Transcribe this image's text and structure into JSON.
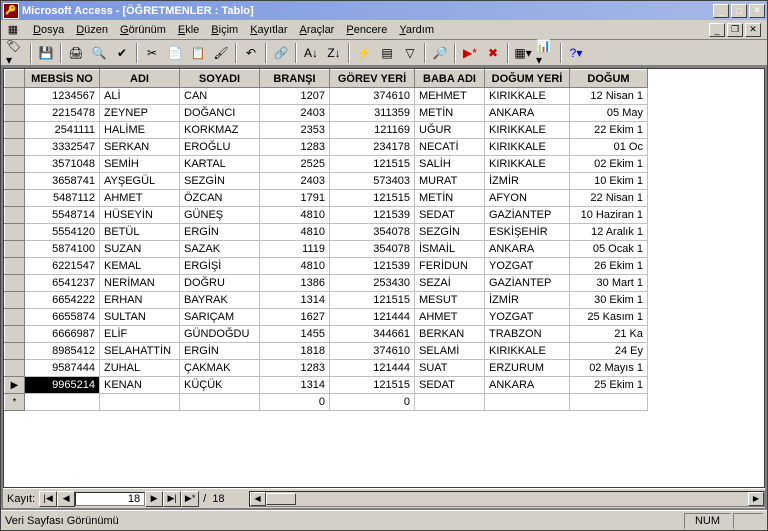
{
  "title": "Microsoft Access - [ÖĞRETMENLER : Tablo]",
  "menus": [
    "Dosya",
    "Düzen",
    "Görünüm",
    "Ekle",
    "Biçim",
    "Kayıtlar",
    "Araçlar",
    "Pencere",
    "Yardım"
  ],
  "columns": [
    "MEBSİS NO",
    "ADI",
    "SOYADI",
    "BRANŞI",
    "GÖREV YERİ",
    "BABA ADI",
    "DOĞUM YERİ",
    "DOĞUM"
  ],
  "rows": [
    {
      "sel": "",
      "mebsis": "1234567",
      "adi": "ALİ",
      "soyadi": "CAN",
      "bransi": "1207",
      "gorev": "374610",
      "baba": "MEHMET",
      "dogumyeri": "KIRIKKALE",
      "dogum": "12 Nisan 1"
    },
    {
      "sel": "",
      "mebsis": "2215478",
      "adi": "ZEYNEP",
      "soyadi": "DOĞANCI",
      "bransi": "2403",
      "gorev": "311359",
      "baba": "METİN",
      "dogumyeri": "ANKARA",
      "dogum": "05 May"
    },
    {
      "sel": "",
      "mebsis": "2541111",
      "adi": "HALİME",
      "soyadi": "KORKMAZ",
      "bransi": "2353",
      "gorev": "121169",
      "baba": "UĞUR",
      "dogumyeri": "KIRIKKALE",
      "dogum": "22 Ekim 1"
    },
    {
      "sel": "",
      "mebsis": "3332547",
      "adi": "SERKAN",
      "soyadi": "EROĞLU",
      "bransi": "1283",
      "gorev": "234178",
      "baba": "NECATİ",
      "dogumyeri": "KIRIKKALE",
      "dogum": "01 Oc"
    },
    {
      "sel": "",
      "mebsis": "3571048",
      "adi": "SEMİH",
      "soyadi": "KARTAL",
      "bransi": "2525",
      "gorev": "121515",
      "baba": "SALİH",
      "dogumyeri": "KIRIKKALE",
      "dogum": "02 Ekim 1"
    },
    {
      "sel": "",
      "mebsis": "3658741",
      "adi": "AYŞEGÜL",
      "soyadi": "SEZGİN",
      "bransi": "2403",
      "gorev": "573403",
      "baba": "MURAT",
      "dogumyeri": "İZMİR",
      "dogum": "10 Ekim 1"
    },
    {
      "sel": "",
      "mebsis": "5487112",
      "adi": "AHMET",
      "soyadi": "ÖZCAN",
      "bransi": "1791",
      "gorev": "121515",
      "baba": "METİN",
      "dogumyeri": "AFYON",
      "dogum": "22 Nisan 1"
    },
    {
      "sel": "",
      "mebsis": "5548714",
      "adi": "HÜSEYİN",
      "soyadi": "GÜNEŞ",
      "bransi": "4810",
      "gorev": "121539",
      "baba": "SEDAT",
      "dogumyeri": "GAZİANTEP",
      "dogum": "10 Haziran 1"
    },
    {
      "sel": "",
      "mebsis": "5554120",
      "adi": "BETÜL",
      "soyadi": "ERGİN",
      "bransi": "4810",
      "gorev": "354078",
      "baba": "SEZGİN",
      "dogumyeri": "ESKİŞEHİR",
      "dogum": "12 Aralık 1"
    },
    {
      "sel": "",
      "mebsis": "5874100",
      "adi": "SUZAN",
      "soyadi": "SAZAK",
      "bransi": "1119",
      "gorev": "354078",
      "baba": "İSMAİL",
      "dogumyeri": "ANKARA",
      "dogum": "05 Ocak 1"
    },
    {
      "sel": "",
      "mebsis": "6221547",
      "adi": "KEMAL",
      "soyadi": "ERGİŞİ",
      "bransi": "4810",
      "gorev": "121539",
      "baba": "FERİDUN",
      "dogumyeri": "YOZGAT",
      "dogum": "26 Ekim 1"
    },
    {
      "sel": "",
      "mebsis": "6541237",
      "adi": "NERİMAN",
      "soyadi": "DOĞRU",
      "bransi": "1386",
      "gorev": "253430",
      "baba": "SEZAİ",
      "dogumyeri": "GAZİANTEP",
      "dogum": "30 Mart 1"
    },
    {
      "sel": "",
      "mebsis": "6654222",
      "adi": "ERHAN",
      "soyadi": "BAYRAK",
      "bransi": "1314",
      "gorev": "121515",
      "baba": "MESUT",
      "dogumyeri": "İZMİR",
      "dogum": "30 Ekim 1"
    },
    {
      "sel": "",
      "mebsis": "6655874",
      "adi": "SULTAN",
      "soyadi": "SARIÇAM",
      "bransi": "1627",
      "gorev": "121444",
      "baba": "AHMET",
      "dogumyeri": "YOZGAT",
      "dogum": "25 Kasım 1"
    },
    {
      "sel": "",
      "mebsis": "6666987",
      "adi": "ELİF",
      "soyadi": "GÜNDOĞDU",
      "bransi": "1455",
      "gorev": "344661",
      "baba": "BERKAN",
      "dogumyeri": "TRABZON",
      "dogum": "21 Ka"
    },
    {
      "sel": "",
      "mebsis": "8985412",
      "adi": "SELAHATTİN",
      "soyadi": "ERGİN",
      "bransi": "1818",
      "gorev": "374610",
      "baba": "SELAMİ",
      "dogumyeri": "KIRIKKALE",
      "dogum": "24 Ey"
    },
    {
      "sel": "",
      "mebsis": "9587444",
      "adi": "ZUHAL",
      "soyadi": "ÇAKMAK",
      "bransi": "1283",
      "gorev": "121444",
      "baba": "SUAT",
      "dogumyeri": "ERZURUM",
      "dogum": "02 Mayıs 1"
    },
    {
      "sel": "▶",
      "mebsis": "9965214",
      "adi": "KENAN",
      "soyadi": "KÜÇÜK",
      "bransi": "1314",
      "gorev": "121515",
      "baba": "SEDAT",
      "dogumyeri": "ANKARA",
      "dogum": "25 Ekim 1",
      "current": true
    },
    {
      "sel": "*",
      "mebsis": "",
      "adi": "",
      "soyadi": "",
      "bransi": "0",
      "gorev": "0",
      "baba": "",
      "dogumyeri": "",
      "dogum": ""
    }
  ],
  "nav": {
    "label": "Kayıt:",
    "current": "18",
    "total": "18",
    "sep": "/"
  },
  "status": {
    "text": "Veri Sayfası Görünümü",
    "num": "NUM"
  }
}
